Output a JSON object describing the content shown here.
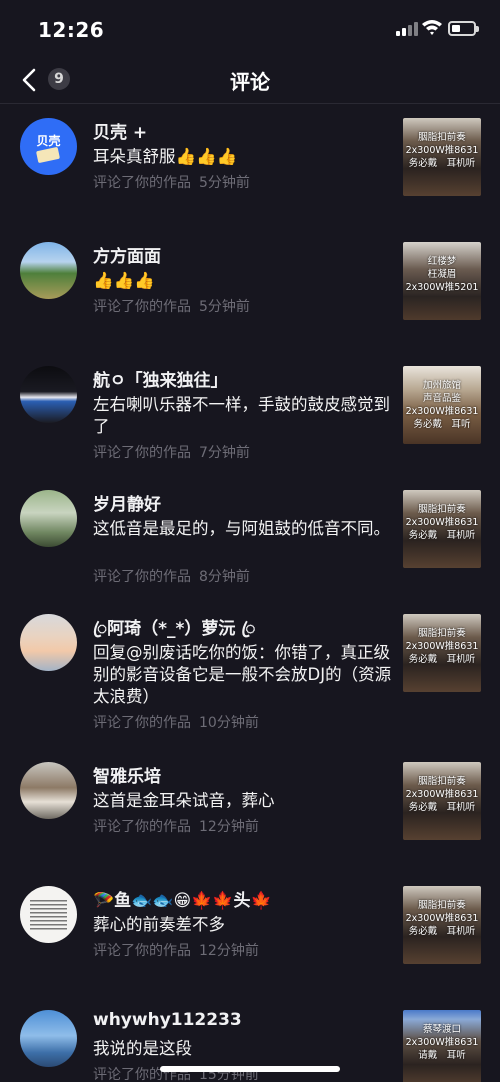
{
  "status": {
    "time": "12:26"
  },
  "header": {
    "title": "评论",
    "count": "9"
  },
  "colors": {
    "background": "#17161f",
    "meta_gray": "#6d6c76",
    "avatar_blue": "#2f6df6"
  },
  "comments": [
    {
      "user": "贝壳 +",
      "text": "耳朵真舒服👍👍👍",
      "action": "评论了你的作品",
      "ago": "5分钟前",
      "avatar_label": "贝壳",
      "thumb": [
        "胭脂扣前奏",
        "2x300W推8631",
        "务必戴　耳机听",
        ""
      ]
    },
    {
      "user": "方方面面",
      "text": "👍👍👍",
      "action": "评论了你的作品",
      "ago": "5分钟前",
      "thumb": [
        "红楼梦",
        "枉凝眉",
        "2x300W推5201",
        ""
      ]
    },
    {
      "user": "航ㅇ「独来独往」",
      "text": "左右喇叭乐器不一样，手鼓的鼓皮感觉到了",
      "action": "评论了你的作品",
      "ago": "7分钟前",
      "thumb": [
        "加州旅馆",
        "声音品鉴",
        "2x300W推8631",
        "务必戴　耳听"
      ]
    },
    {
      "user": "岁月静好",
      "text": "这低音是最足的，与阿姐鼓的低音不同。",
      "action": "评论了你的作品",
      "ago": "8分钟前",
      "thumb": [
        "胭脂扣前奏",
        "2x300W推8631",
        "务必戴　耳机听",
        ""
      ]
    },
    {
      "user": "ꦿ阿琦（*_*）萝沅 ꦿ",
      "text": "回复@别废话吃你的饭：你错了，真正级别的影音设备它是一般不会放DJ的（资源太浪费）",
      "action": "评论了你的作品",
      "ago": "10分钟前",
      "thumb": [
        "胭脂扣前奏",
        "2x300W推8631",
        "务必戴　耳机听",
        ""
      ]
    },
    {
      "user": "智雅乐培",
      "text": "这首是金耳朵试音，葬心",
      "action": "评论了你的作品",
      "ago": "12分钟前",
      "thumb": [
        "胭脂扣前奏",
        "2x300W推8631",
        "务必戴　耳机听",
        ""
      ]
    },
    {
      "user": "🪂鱼🐟🐟😁🍁🍁头🍁",
      "text": "葬心的前奏差不多",
      "action": "评论了你的作品",
      "ago": "12分钟前",
      "thumb": [
        "胭脂扣前奏",
        "2x300W推8631",
        "务必戴　耳机听",
        ""
      ]
    },
    {
      "user": "whywhy112233",
      "text": "我说的是这段",
      "action": "评论了你的作品",
      "ago": "15分钟前",
      "thumb": [
        "蔡琴渡口",
        "2x300W推8631",
        "请戴　耳听",
        ""
      ]
    }
  ]
}
